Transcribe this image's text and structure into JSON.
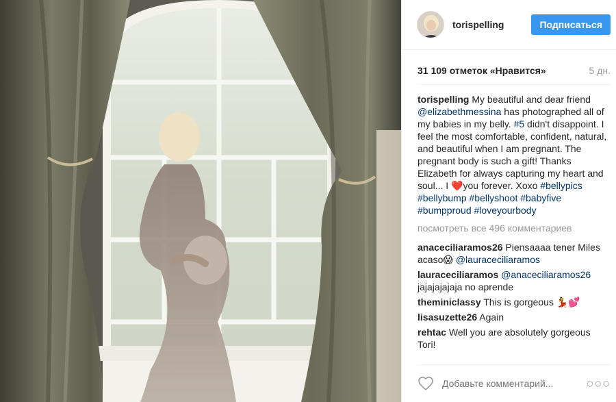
{
  "post": {
    "username": "torispelling",
    "follow_label": "Подписаться",
    "likes": "31 109 отметок «Нравится»",
    "time_ago": "5 дн.",
    "caption": {
      "user": "torispelling",
      "parts": [
        {
          "t": " My beautiful and dear friend "
        },
        {
          "t": "@elizabethmessina",
          "tag": true
        },
        {
          "t": " has photographed all of my babies in my belly. "
        },
        {
          "t": "#5",
          "tag": true
        },
        {
          "t": " didn't disappoint. I feel the most comfortable, confident, natural, and beautiful when I am pregnant. The pregnant body is such a gift! Thanks Elizabeth for always capturing my heart and soul... I "
        },
        {
          "t": "❤️"
        },
        {
          "t": "you forever. Xoxo "
        },
        {
          "t": "#bellypics",
          "tag": true
        },
        {
          "t": " "
        },
        {
          "t": "#bellybump",
          "tag": true
        },
        {
          "t": " "
        },
        {
          "t": "#bellyshoot",
          "tag": true
        },
        {
          "t": " "
        },
        {
          "t": "#babyfive",
          "tag": true
        },
        {
          "t": " "
        },
        {
          "t": "#bumpproud",
          "tag": true
        },
        {
          "t": " "
        },
        {
          "t": "#loveyourbody",
          "tag": true
        }
      ]
    },
    "view_all": "посмотреть все 496 комментариев",
    "comments": [
      {
        "user": "anaceciliaramos26",
        "parts": [
          {
            "t": " Piensaaaa tener Miles acaso😱 "
          },
          {
            "t": "@lauraceciliaramos",
            "tag": true
          }
        ]
      },
      {
        "user": "lauraceciliaramos",
        "parts": [
          {
            "t": " "
          },
          {
            "t": "@anaceciliaramos26",
            "tag": true
          },
          {
            "t": " jajajajajaja no aprende"
          }
        ]
      },
      {
        "user": "theminiclassy",
        "parts": [
          {
            "t": " This is gorgeous 💃💕"
          }
        ]
      },
      {
        "user": "lisasuzette26",
        "parts": [
          {
            "t": " Again"
          }
        ]
      },
      {
        "user": "rehtac",
        "parts": [
          {
            "t": " Well you are absolutely gorgeous Tori!"
          }
        ]
      }
    ],
    "add_comment_placeholder": "Добавьте комментарий...",
    "more_dots": "○○○"
  }
}
